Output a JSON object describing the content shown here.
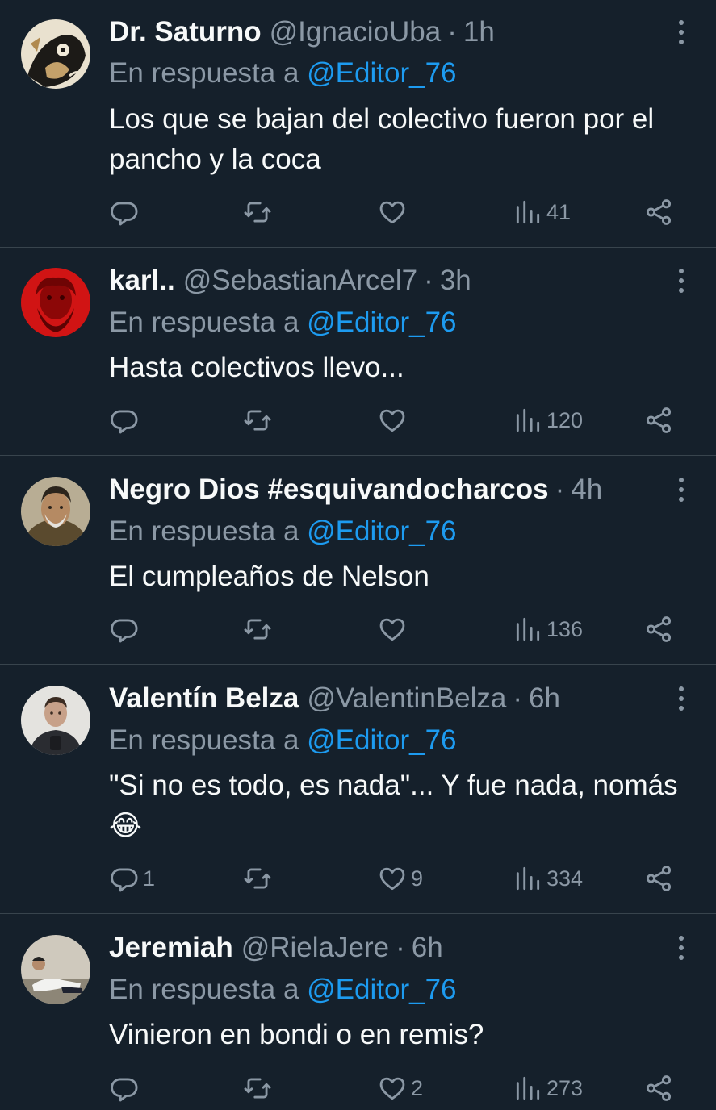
{
  "tweets": [
    {
      "name": "Dr. Saturno",
      "handle": "@IgnacioUba",
      "time": "1h",
      "reply_prefix": "En respuesta a ",
      "reply_handle": "@Editor_76",
      "text": "Los que se bajan del colectivo fueron por el pancho y la coca",
      "replies": "",
      "retweets": "",
      "likes": "",
      "views": "41",
      "avatar_color": "#9a7a50"
    },
    {
      "name": "karl..",
      "handle": "@SebastianArcel7",
      "time": "3h",
      "reply_prefix": "En respuesta a ",
      "reply_handle": "@Editor_76",
      "text": "Hasta colectivos llevo...",
      "replies": "",
      "retweets": "",
      "likes": "",
      "views": "120",
      "avatar_color": "#d11414"
    },
    {
      "name": "Negro Dios #esquivandocharcos",
      "handle": "",
      "time": "4h",
      "reply_prefix": "En respuesta a ",
      "reply_handle": "@Editor_76",
      "text": "El cumpleaños de Nelson",
      "replies": "",
      "retweets": "",
      "likes": "",
      "views": "136",
      "avatar_color": "#6b5a3e"
    },
    {
      "name": "Valentín Belza",
      "handle": "@ValentinBelza",
      "time": "6h",
      "reply_prefix": "En respuesta a ",
      "reply_handle": "@Editor_76",
      "text": "\"Si no es todo, es nada\"... Y fue nada, nomás 😂",
      "replies": "1",
      "retweets": "",
      "likes": "9",
      "views": "334",
      "avatar_color": "#d8d8d4"
    },
    {
      "name": "Jeremiah",
      "handle": "@RielaJere",
      "time": "6h",
      "reply_prefix": "En respuesta a ",
      "reply_handle": "@Editor_76",
      "text": "Vinieron en bondi o en remis?",
      "replies": "",
      "retweets": "",
      "likes": "2",
      "views": "273",
      "avatar_color": "#cfc9bd"
    }
  ],
  "icons": {
    "reply": "reply-icon",
    "retweet": "retweet-icon",
    "like": "heart-icon",
    "views": "views-icon",
    "share": "share-icon",
    "more": "more-icon"
  },
  "colors": {
    "background": "#15202b",
    "text": "#f7f9f9",
    "secondary": "#8b98a5",
    "link": "#1d9bf0",
    "divider": "#38444d"
  }
}
